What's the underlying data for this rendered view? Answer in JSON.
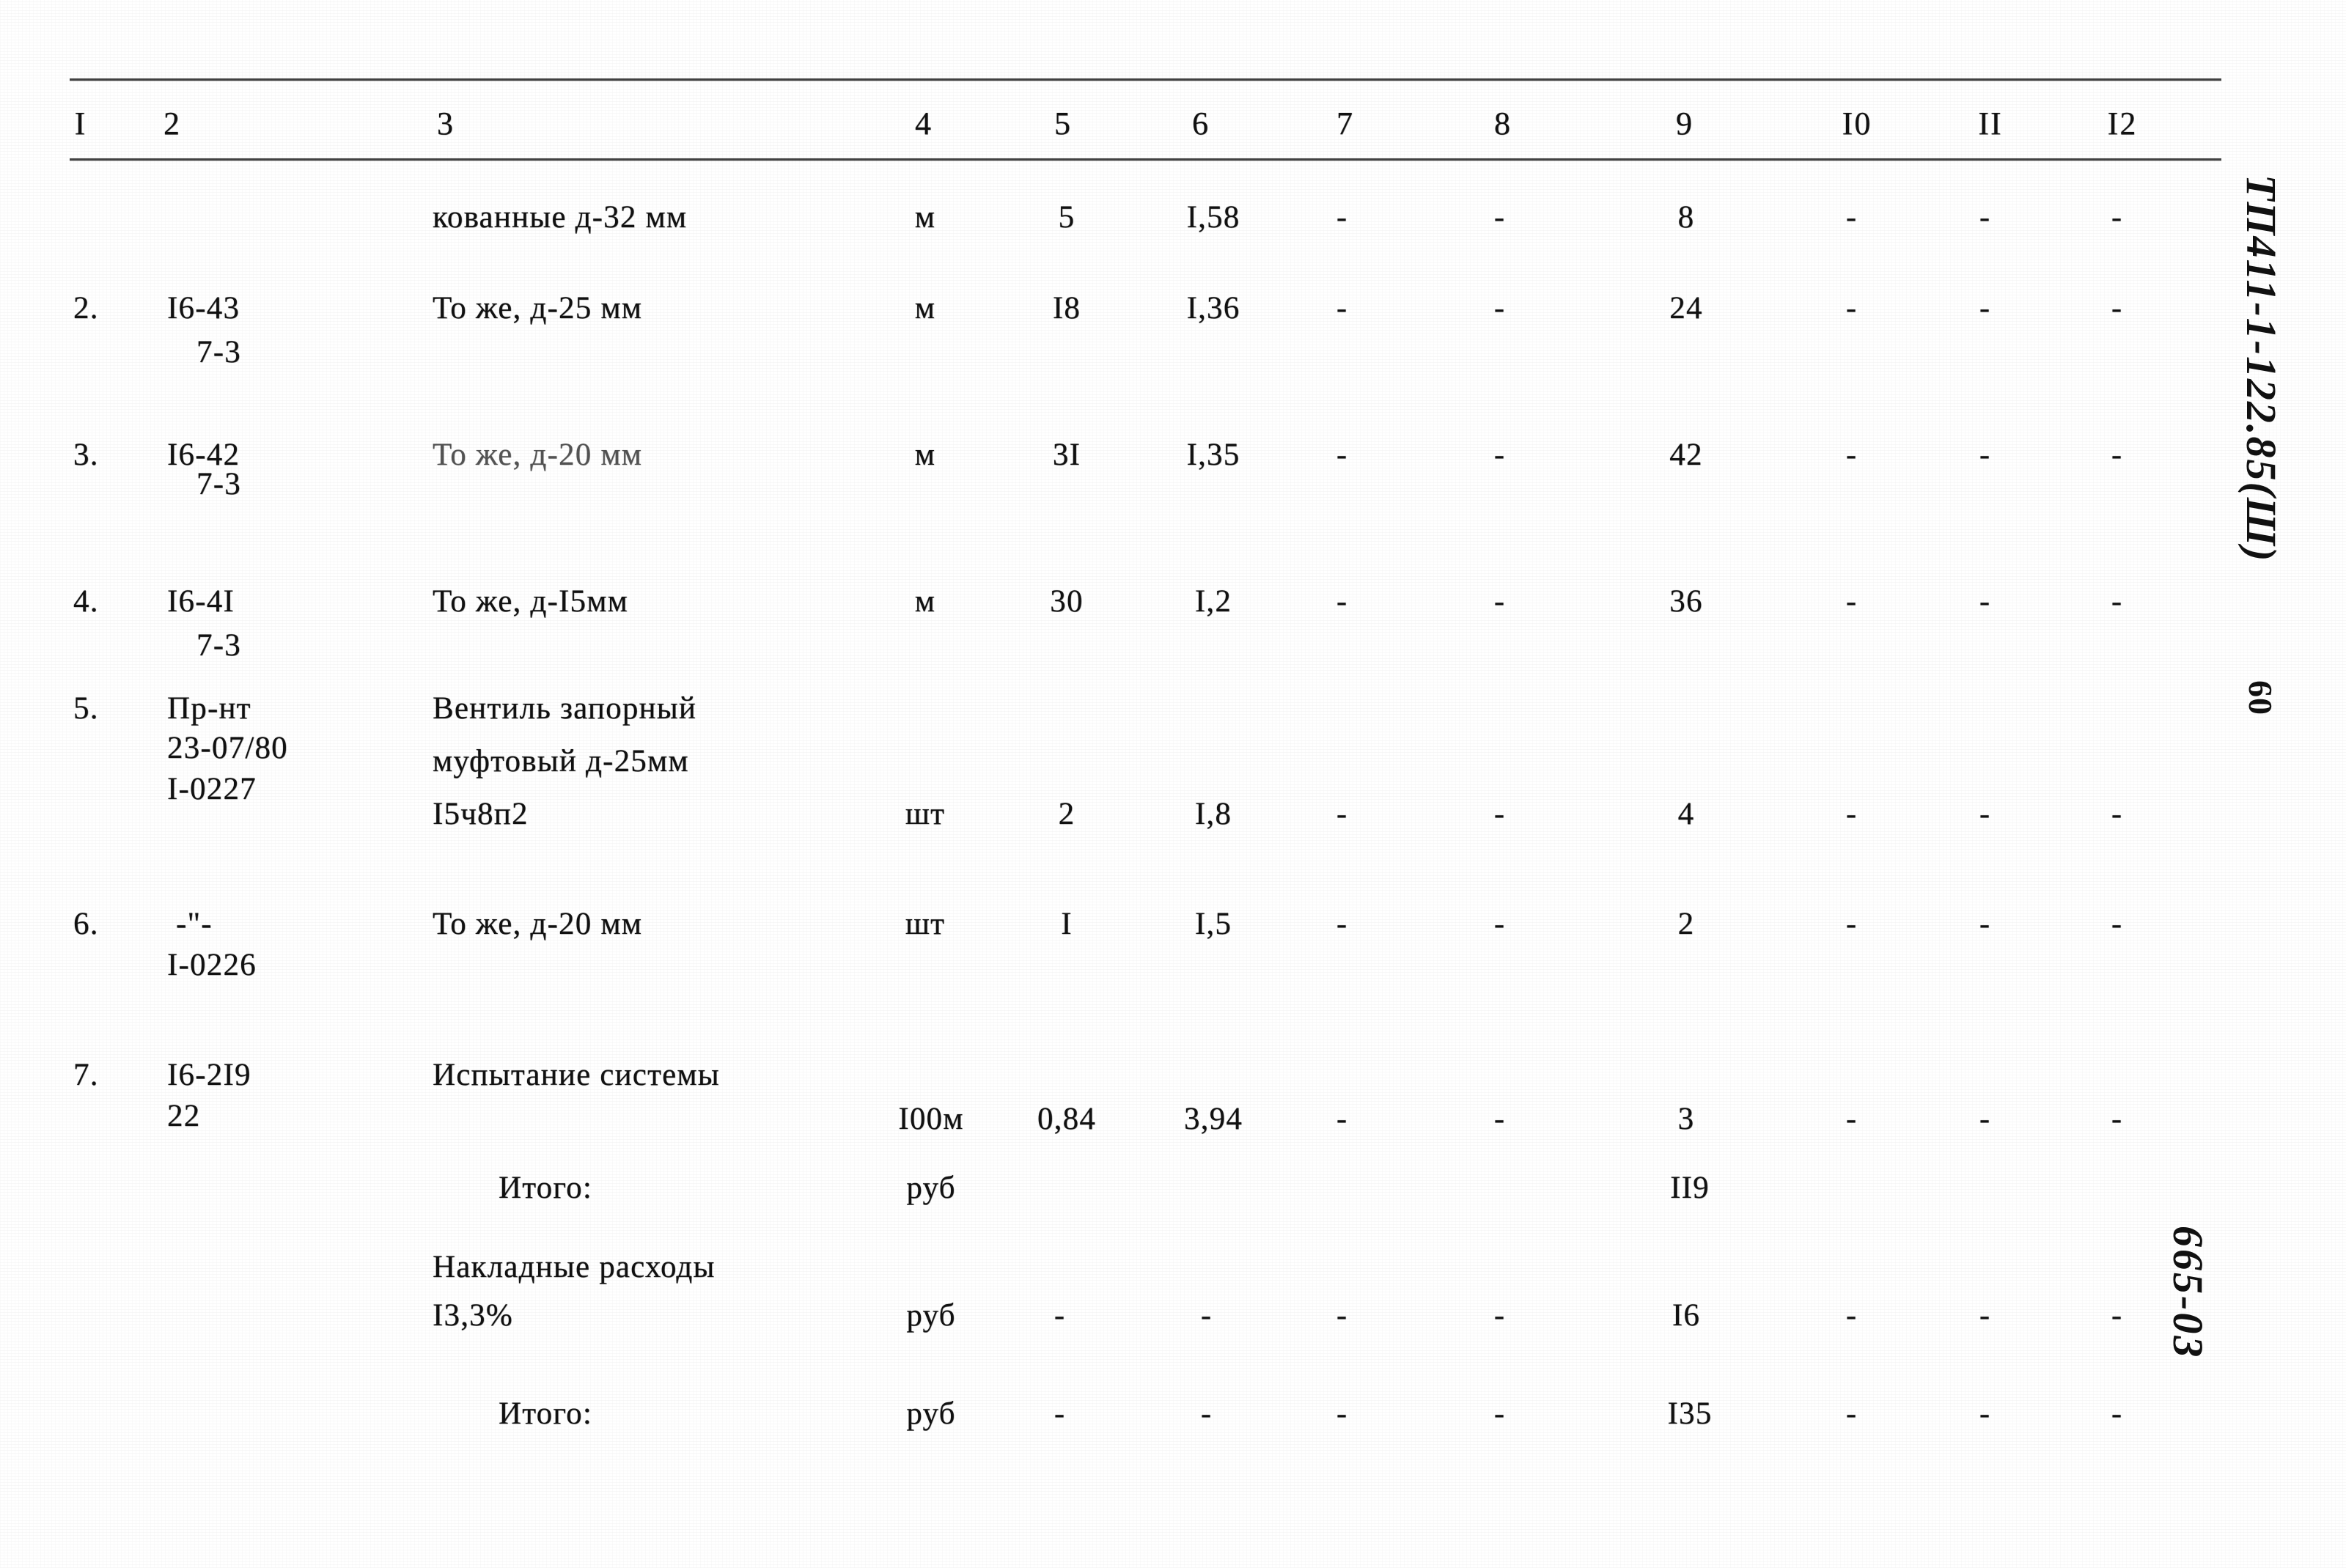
{
  "document": {
    "doc_code": "ТП411-1-122.85(Ш)",
    "page_number": "60",
    "sheet_number": "665-03"
  },
  "table": {
    "column_headers": [
      "I",
      "2",
      "3",
      "4",
      "5",
      "6",
      "7",
      "8",
      "9",
      "I0",
      "II",
      "I2"
    ],
    "dash": "-",
    "rows": [
      {
        "c1": "",
        "c2": "",
        "c2b": "",
        "c2c": "",
        "c3": "кованные д-32 мм",
        "c3b": "",
        "c3c": "",
        "c4": "м",
        "c5": "5",
        "c6": "I,58",
        "c7": "-",
        "c8": "-",
        "c9": "8",
        "c10": "-",
        "c11": "-",
        "c12": "-"
      },
      {
        "c1": "2.",
        "c2": "I6-43",
        "c2b": "7-3",
        "c2c": "",
        "c3": "То же, д-25 мм",
        "c3b": "",
        "c3c": "",
        "c4": "м",
        "c5": "I8",
        "c6": "I,36",
        "c7": "-",
        "c8": "-",
        "c9": "24",
        "c10": "-",
        "c11": "-",
        "c12": "-"
      },
      {
        "c1": "3.",
        "c2": "I6-42",
        "c2b": "7-3",
        "c2c": "",
        "c3": "То же, д-20 мм",
        "c3b": "",
        "c3c": "",
        "c4": "м",
        "c5": "3I",
        "c6": "I,35",
        "c7": "-",
        "c8": "-",
        "c9": "42",
        "c10": "-",
        "c11": "-",
        "c12": "-"
      },
      {
        "c1": "4.",
        "c2": "I6-4I",
        "c2b": "7-3",
        "c2c": "",
        "c3": "То же, д-I5мм",
        "c3b": "",
        "c3c": "",
        "c4": "м",
        "c5": "30",
        "c6": "I,2",
        "c7": "-",
        "c8": "-",
        "c9": "36",
        "c10": "-",
        "c11": "-",
        "c12": "-"
      },
      {
        "c1": "5.",
        "c2": "Пр-нт",
        "c2b": "23-07/80",
        "c2c": "I-0227",
        "c3": "Вентиль запорный",
        "c3b": "муфтовый д-25мм",
        "c3c": "I5ч8п2",
        "c4": "шт",
        "c5": "2",
        "c6": "I,8",
        "c7": "-",
        "c8": "-",
        "c9": "4",
        "c10": "-",
        "c11": "-",
        "c12": "-"
      },
      {
        "c1": "6.",
        "c2": "-\"-",
        "c2b": "I-0226",
        "c2c": "",
        "c3": "То же, д-20 мм",
        "c3b": "",
        "c3c": "",
        "c4": "шт",
        "c5": "I",
        "c6": "I,5",
        "c7": "-",
        "c8": "-",
        "c9": "2",
        "c10": "-",
        "c11": "-",
        "c12": "-"
      },
      {
        "c1": "7.",
        "c2": "I6-2I9",
        "c2b": "22",
        "c2c": "",
        "c3": "Испытание системы",
        "c3b": "",
        "c3c": "",
        "c4": "I00м",
        "c5": "0,84",
        "c6": "3,94",
        "c7": "-",
        "c8": "-",
        "c9": "3",
        "c10": "-",
        "c11": "-",
        "c12": "-"
      }
    ],
    "summary_rows": [
      {
        "label": "Итого:",
        "label2": "",
        "unit": "руб",
        "c5": "",
        "c6": "",
        "c7": "",
        "c8": "",
        "c9": "II9",
        "c10": "",
        "c11": "",
        "c12": ""
      },
      {
        "label": "Накладные расходы",
        "label2": "I3,3%",
        "unit": "руб",
        "c5": "-",
        "c6": "-",
        "c7": "-",
        "c8": "-",
        "c9": "I6",
        "c10": "-",
        "c11": "-",
        "c12": "-"
      },
      {
        "label": "Итого:",
        "label2": "",
        "unit": "руб",
        "c5": "-",
        "c6": "-",
        "c7": "-",
        "c8": "-",
        "c9": "I35",
        "c10": "-",
        "c11": "-",
        "c12": "-"
      }
    ]
  }
}
